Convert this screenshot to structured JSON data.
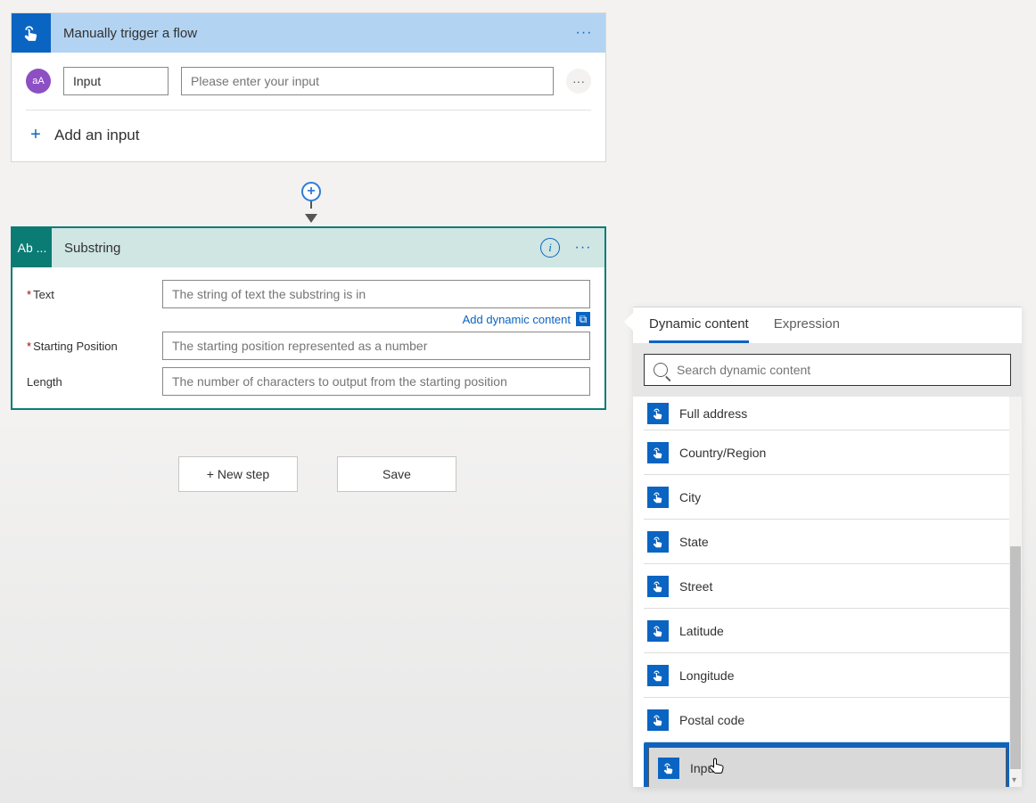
{
  "trigger": {
    "title": "Manually trigger a flow",
    "icon_name": "tap-icon",
    "param_badge": "aA",
    "input_name": "Input",
    "input_desc_placeholder": "Please enter your input",
    "add_input_label": "Add an input"
  },
  "action": {
    "icon_text": "Ab ...",
    "title": "Substring",
    "fields": {
      "text_label": "Text",
      "text_placeholder": "The string of text the substring is in",
      "start_label": "Starting Position",
      "start_placeholder": "The starting position represented as a number",
      "length_label": "Length",
      "length_placeholder": "The number of characters to output from the starting position"
    },
    "add_dc_label": "Add dynamic content"
  },
  "bottom": {
    "new_step": "+ New step",
    "save": "Save"
  },
  "dc_panel": {
    "tab_dynamic": "Dynamic content",
    "tab_expression": "Expression",
    "search_placeholder": "Search dynamic content",
    "items": [
      "Full address",
      "Country/Region",
      "City",
      "State",
      "Street",
      "Latitude",
      "Longitude",
      "Postal code",
      "Input"
    ]
  },
  "colors": {
    "ms_blue": "#0a64c2",
    "teal": "#0a7c74"
  }
}
